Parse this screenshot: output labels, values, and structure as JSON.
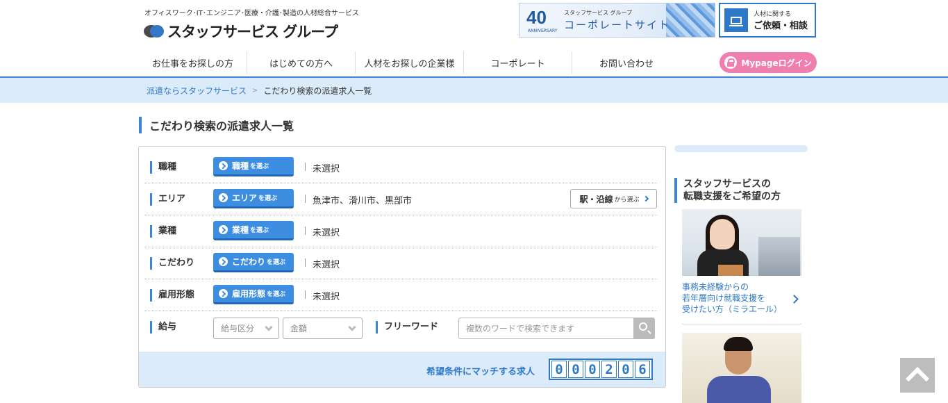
{
  "header": {
    "tagline": "オフィスワーク･IT･エンジニア･医療・介護･製造の人材総合サービス",
    "logo_text": "スタッフサービス グループ",
    "corporate_banner": {
      "badge": "40",
      "anniversary": "ANNIVERSARY",
      "group": "スタッフサービス グループ",
      "title": "コーポレートサイト"
    },
    "consult": {
      "small": "人材に関する",
      "large": "ご依頼・相談"
    }
  },
  "gnav": {
    "items": [
      "お仕事をお探しの方",
      "はじめての方へ",
      "人材をお探しの企業様",
      "コーポレート",
      "お問い合わせ"
    ],
    "mypage": "Mypageログイン"
  },
  "breadcrumb": {
    "home": "派遣ならスタッフサービス",
    "separator": ">",
    "current": "こだわり検索の派遣求人一覧"
  },
  "page_title": "こだわり検索の派遣求人一覧",
  "search": {
    "rows": [
      {
        "label": "職種",
        "button": "職種",
        "button_suffix": "を選ぶ",
        "value": "未選択"
      },
      {
        "label": "エリア",
        "button": "エリア",
        "button_suffix": "を選ぶ",
        "value": "魚津市、滑川市、黒部市"
      },
      {
        "label": "業種",
        "button": "業種",
        "button_suffix": "を選ぶ",
        "value": "未選択"
      },
      {
        "label": "こだわり",
        "button": "こだわり",
        "button_suffix": "を選ぶ",
        "value": "未選択"
      },
      {
        "label": "雇用形態",
        "button": "雇用形態",
        "button_suffix": "を選ぶ",
        "value": "未選択"
      }
    ],
    "station_button": {
      "main": "駅・沿線",
      "suffix": "から選ぶ"
    },
    "salary": {
      "label": "給与",
      "type_select": "給与区分",
      "amount_select": "金額"
    },
    "freeword": {
      "label": "フリーワード",
      "placeholder": "複数のワードで検索できます",
      "value": ""
    },
    "match_label": "希望条件にマッチする求人",
    "count_digits": [
      "0",
      "0",
      "0",
      "2",
      "0",
      "6"
    ]
  },
  "sidebar": {
    "heading_line1": "スタッフサービスの",
    "heading_line2": "転職支援をご希望の方",
    "link1": "事務未経験からの\n若年層向け就職支援を\n受けたい方（ミラエール）"
  },
  "colors": {
    "accent": "#3d86d6",
    "breadcrumb_bg": "#dcebfa",
    "mypage_pink": "#f07fb0",
    "button_blue": "#3d8ee0"
  }
}
